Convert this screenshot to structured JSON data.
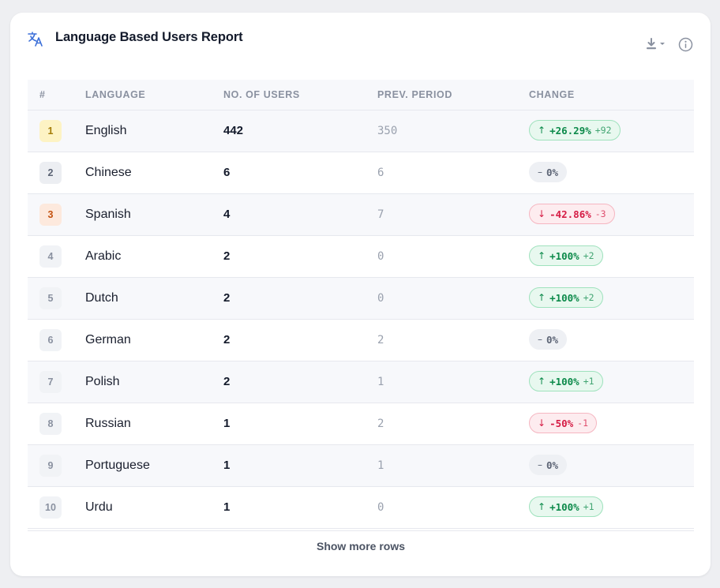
{
  "report": {
    "title": "Language Based Users Report",
    "download_icon": "download-icon",
    "info_icon": "info-icon"
  },
  "table": {
    "headers": {
      "rank": "#",
      "language": "LANGUAGE",
      "users": "NO. OF USERS",
      "prev": "PREV. PERIOD",
      "change": "CHANGE"
    },
    "rows": [
      {
        "rank": "1",
        "language": "English",
        "users": "442",
        "prev": "350",
        "trend": "up",
        "arrow": "↑",
        "pct": "+26.29%",
        "delta": "+92"
      },
      {
        "rank": "2",
        "language": "Chinese",
        "users": "6",
        "prev": "6",
        "trend": "flat",
        "arrow": "–",
        "pct": "0%",
        "delta": ""
      },
      {
        "rank": "3",
        "language": "Spanish",
        "users": "4",
        "prev": "7",
        "trend": "down",
        "arrow": "↓",
        "pct": "-42.86%",
        "delta": "-3"
      },
      {
        "rank": "4",
        "language": "Arabic",
        "users": "2",
        "prev": "0",
        "trend": "up",
        "arrow": "↑",
        "pct": "+100%",
        "delta": "+2"
      },
      {
        "rank": "5",
        "language": "Dutch",
        "users": "2",
        "prev": "0",
        "trend": "up",
        "arrow": "↑",
        "pct": "+100%",
        "delta": "+2"
      },
      {
        "rank": "6",
        "language": "German",
        "users": "2",
        "prev": "2",
        "trend": "flat",
        "arrow": "–",
        "pct": "0%",
        "delta": ""
      },
      {
        "rank": "7",
        "language": "Polish",
        "users": "2",
        "prev": "1",
        "trend": "up",
        "arrow": "↑",
        "pct": "+100%",
        "delta": "+1"
      },
      {
        "rank": "8",
        "language": "Russian",
        "users": "1",
        "prev": "2",
        "trend": "down",
        "arrow": "↓",
        "pct": "-50%",
        "delta": "-1"
      },
      {
        "rank": "9",
        "language": "Portuguese",
        "users": "1",
        "prev": "1",
        "trend": "flat",
        "arrow": "–",
        "pct": "0%",
        "delta": ""
      },
      {
        "rank": "10",
        "language": "Urdu",
        "users": "1",
        "prev": "0",
        "trend": "up",
        "arrow": "↑",
        "pct": "+100%",
        "delta": "+1"
      }
    ]
  },
  "footer": {
    "show_more_label": "Show more rows"
  },
  "colors": {
    "accent": "#3b6fd8",
    "up": "#0c8a4a",
    "down": "#d51b44",
    "flat": "#5c6475"
  }
}
